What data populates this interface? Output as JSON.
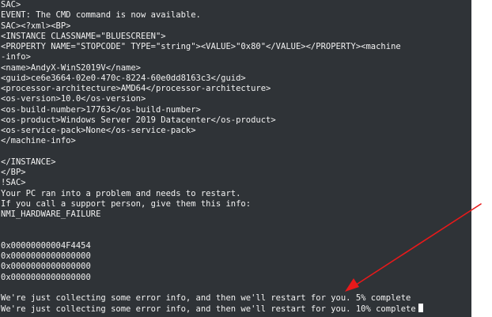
{
  "console": {
    "lines": [
      "SAC>",
      "EVENT: The CMD command is now available.",
      "SAC><?xml><BP>",
      "<INSTANCE CLASSNAME=\"BLUESCREEN\">",
      "<PROPERTY NAME=\"STOPCODE\" TYPE=\"string\"><VALUE>\"0x80\"</VALUE></PROPERTY><machine",
      "-info>",
      "<name>AndyX-WinS2019V</name>",
      "<guid>ce6e3664-02e0-470c-8224-60e0dd8163c3</guid>",
      "<processor-architecture>AMD64</processor-architecture>",
      "<os-version>10.0</os-version>",
      "<os-build-number>17763</os-build-number>",
      "<os-product>Windows Server 2019 Datacenter</os-product>",
      "<os-service-pack>None</os-service-pack>",
      "</machine-info>",
      "",
      "</INSTANCE>",
      "</BP>",
      "!SAC>",
      "Your PC ran into a problem and needs to restart.",
      "If you call a support person, give them this info:",
      "NMI_HARDWARE_FAILURE",
      "",
      "",
      "0x00000000004F4454",
      "0x0000000000000000",
      "0x0000000000000000",
      "0x0000000000000000",
      "",
      "We're just collecting some error info, and then we'll restart for you. 5% complete",
      "We're just collecting some error info, and then we'll restart for you. 10% complete"
    ]
  },
  "annotation": {
    "arrow_color": "#e8191a"
  }
}
